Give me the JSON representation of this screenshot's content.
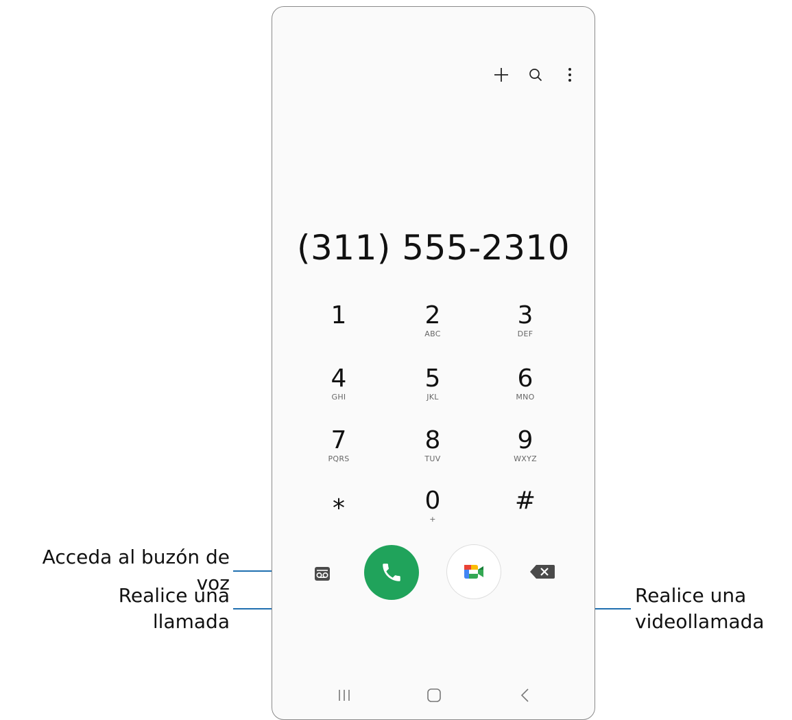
{
  "dialer": {
    "number": "(311) 555-2310",
    "keys": [
      {
        "digit": "1",
        "letters": ""
      },
      {
        "digit": "2",
        "letters": "ABC"
      },
      {
        "digit": "3",
        "letters": "DEF"
      },
      {
        "digit": "4",
        "letters": "GHI"
      },
      {
        "digit": "5",
        "letters": "JKL"
      },
      {
        "digit": "6",
        "letters": "MNO"
      },
      {
        "digit": "7",
        "letters": "PQRS"
      },
      {
        "digit": "8",
        "letters": "TUV"
      },
      {
        "digit": "9",
        "letters": "WXYZ"
      },
      {
        "digit": "⁎",
        "letters": ""
      },
      {
        "digit": "0",
        "letters": "+"
      },
      {
        "digit": "#",
        "letters": ""
      }
    ]
  },
  "icons": {
    "top": [
      "plus-icon",
      "search-icon",
      "more-options-icon"
    ],
    "bottom": [
      "voicemail-icon",
      "phone-icon",
      "google-meet-icon",
      "backspace-icon"
    ],
    "nav": [
      "recents-icon",
      "home-icon",
      "back-icon"
    ]
  },
  "colors": {
    "call_green": "#20a35b",
    "callout_line": "#1f6fb0"
  },
  "callouts": {
    "voicemail_line1": "Acceda al buzón de",
    "voicemail_line2": "voz",
    "call_line1": "Realice una",
    "call_line2": "llamada",
    "video_line1": "Realice una",
    "video_line2": "videollamada"
  }
}
